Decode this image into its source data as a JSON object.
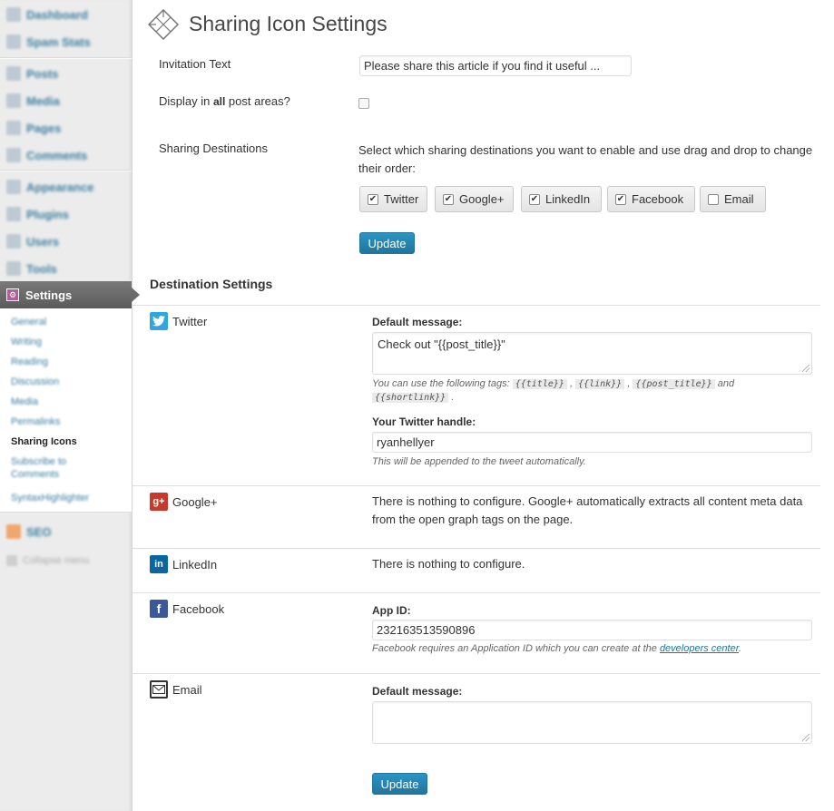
{
  "sidebar": {
    "items": [
      {
        "label": "Dashboard"
      },
      {
        "label": "Spam Stats"
      },
      {
        "label": "Posts"
      },
      {
        "label": "Media"
      },
      {
        "label": "Pages"
      },
      {
        "label": "Comments"
      },
      {
        "label": "Appearance"
      },
      {
        "label": "Plugins"
      },
      {
        "label": "Users"
      },
      {
        "label": "Tools"
      }
    ],
    "settings_label": "Settings",
    "submenu": [
      {
        "label": "General"
      },
      {
        "label": "Writing"
      },
      {
        "label": "Reading"
      },
      {
        "label": "Discussion"
      },
      {
        "label": "Media"
      },
      {
        "label": "Permalinks"
      },
      {
        "label": "Sharing Icons"
      },
      {
        "label": "Subscribe to Comments"
      },
      {
        "label": "SyntaxHighlighter"
      }
    ],
    "seo_label": "SEO",
    "collapse_label": "Collapse menu"
  },
  "page": {
    "title": "Sharing Icon Settings"
  },
  "form": {
    "invitation_label": "Invitation Text",
    "invitation_value": "Please share this article if you find it useful ...",
    "display_label_pre": "Display in ",
    "display_label_bold": "all",
    "display_label_post": " post areas?",
    "display_checked": false,
    "destinations_label": "Sharing Destinations",
    "destinations_desc": "Select which sharing destinations you want to enable and use drag and drop to change their order:",
    "destinations": [
      {
        "label": "Twitter",
        "checked": true
      },
      {
        "label": "Google+",
        "checked": true
      },
      {
        "label": "LinkedIn",
        "checked": true
      },
      {
        "label": "Facebook",
        "checked": true
      },
      {
        "label": "Email",
        "checked": false
      }
    ],
    "update_label": "Update"
  },
  "destination_settings": {
    "title": "Destination Settings",
    "twitter": {
      "name": "Twitter",
      "default_message_label": "Default message:",
      "default_message_value": "Check out \"{{post_title}}\"",
      "tags_hint_pre": "You can use the following tags: ",
      "tags": [
        "{{title}}",
        "{{link}}",
        "{{post_title}}",
        "{{shortlink}}"
      ],
      "tags_and": "and",
      "handle_label": "Your Twitter handle:",
      "handle_value": "ryanhellyer",
      "handle_hint": "This will be appended to the tweet automatically."
    },
    "googleplus": {
      "name": "Google+",
      "text": "There is nothing to configure. Google+ automatically extracts all content meta data from the open graph tags on the page."
    },
    "linkedin": {
      "name": "LinkedIn",
      "text": "There is nothing to configure."
    },
    "facebook": {
      "name": "Facebook",
      "app_id_label": "App ID:",
      "app_id_value": "232163513590896",
      "hint_pre": "Facebook requires an Application ID which you can create at the ",
      "hint_link": "developers center",
      "hint_post": "."
    },
    "email": {
      "name": "Email",
      "default_message_label": "Default message:",
      "default_message_value": ""
    },
    "update_label": "Update"
  },
  "colors": {
    "primary_button": "#21759b",
    "twitter": "#2ca7e0",
    "googleplus": "#c8392b",
    "linkedin": "#0a66a3",
    "facebook": "#3b5998"
  }
}
